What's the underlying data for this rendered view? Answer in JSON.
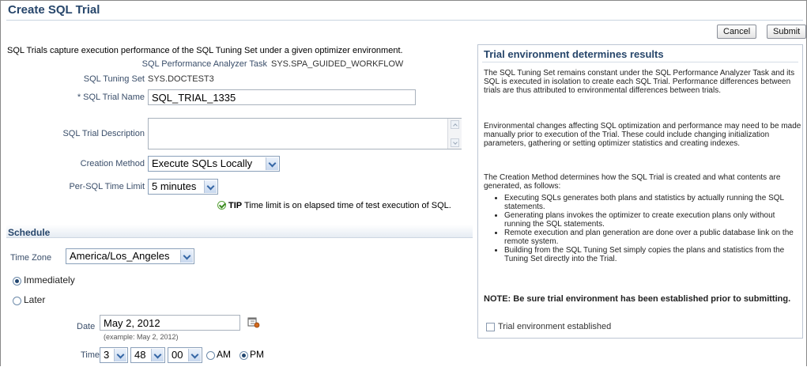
{
  "page": {
    "title": "Create SQL Trial"
  },
  "buttons": {
    "cancel": "Cancel",
    "submit": "Submit"
  },
  "form": {
    "intro": "SQL Trials capture execution performance of the SQL Tuning Set under a given optimizer environment.",
    "spa_task_label": "SQL Performance Analyzer Task",
    "spa_task_value": "SYS.SPA_GUIDED_WORKFLOW",
    "sts_label": "SQL Tuning Set",
    "sts_value": "SYS.DOCTEST3",
    "trial_name_label": "* SQL Trial Name",
    "trial_name_value": "SQL_TRIAL_1335",
    "description_label": "SQL Trial Description",
    "description_value": "",
    "creation_method_label": "Creation Method",
    "creation_method_value": "Execute SQLs Locally",
    "time_limit_label": "Per-SQL Time Limit",
    "time_limit_value": "5 minutes",
    "tip_label": "TIP",
    "tip_text": "Time limit is on elapsed time of test execution of SQL."
  },
  "schedule": {
    "title": "Schedule",
    "timezone_label": "Time Zone",
    "timezone_value": "America/Los_Angeles",
    "immediately_label": "Immediately",
    "later_label": "Later",
    "selected": "Immediately",
    "date_label": "Date",
    "date_value": "May 2, 2012",
    "date_example": "(example: May 2, 2012)",
    "time_label": "Time",
    "hour": "3",
    "minute": "48",
    "second": "00",
    "am_label": "AM",
    "pm_label": "PM",
    "ampm_selected": "PM"
  },
  "panel": {
    "title": "Trial environment determines results",
    "p1": "The SQL Tuning Set remains constant under the SQL Performance Analyzer Task and its SQL is executed in isolation to create each SQL Trial. Performance differences between trials are thus attributed to environmental differences between trials.",
    "p2": "Environmental changes affecting SQL optimization and performance may need to be made manually prior to execution of the Trial. These could include changing initialization parameters, gathering or setting optimizer statistics and creating indexes.",
    "p3": "The Creation Method determines how the SQL Trial is created and what contents are generated, as follows:",
    "bullets": [
      "Executing SQLs generates both plans and statistics by actually running the SQL statements.",
      "Generating plans invokes the optimizer to create execution plans only without running the SQL statements.",
      "Remote execution and plan generation are done over a public database link on the remote system.",
      "Building from the SQL Tuning Set simply copies the plans and statistics from the Tuning Set directly into the Trial."
    ],
    "note": "NOTE: Be sure trial environment has been established prior to submitting.",
    "checkbox_label": "Trial environment established",
    "checkbox_checked": false
  }
}
